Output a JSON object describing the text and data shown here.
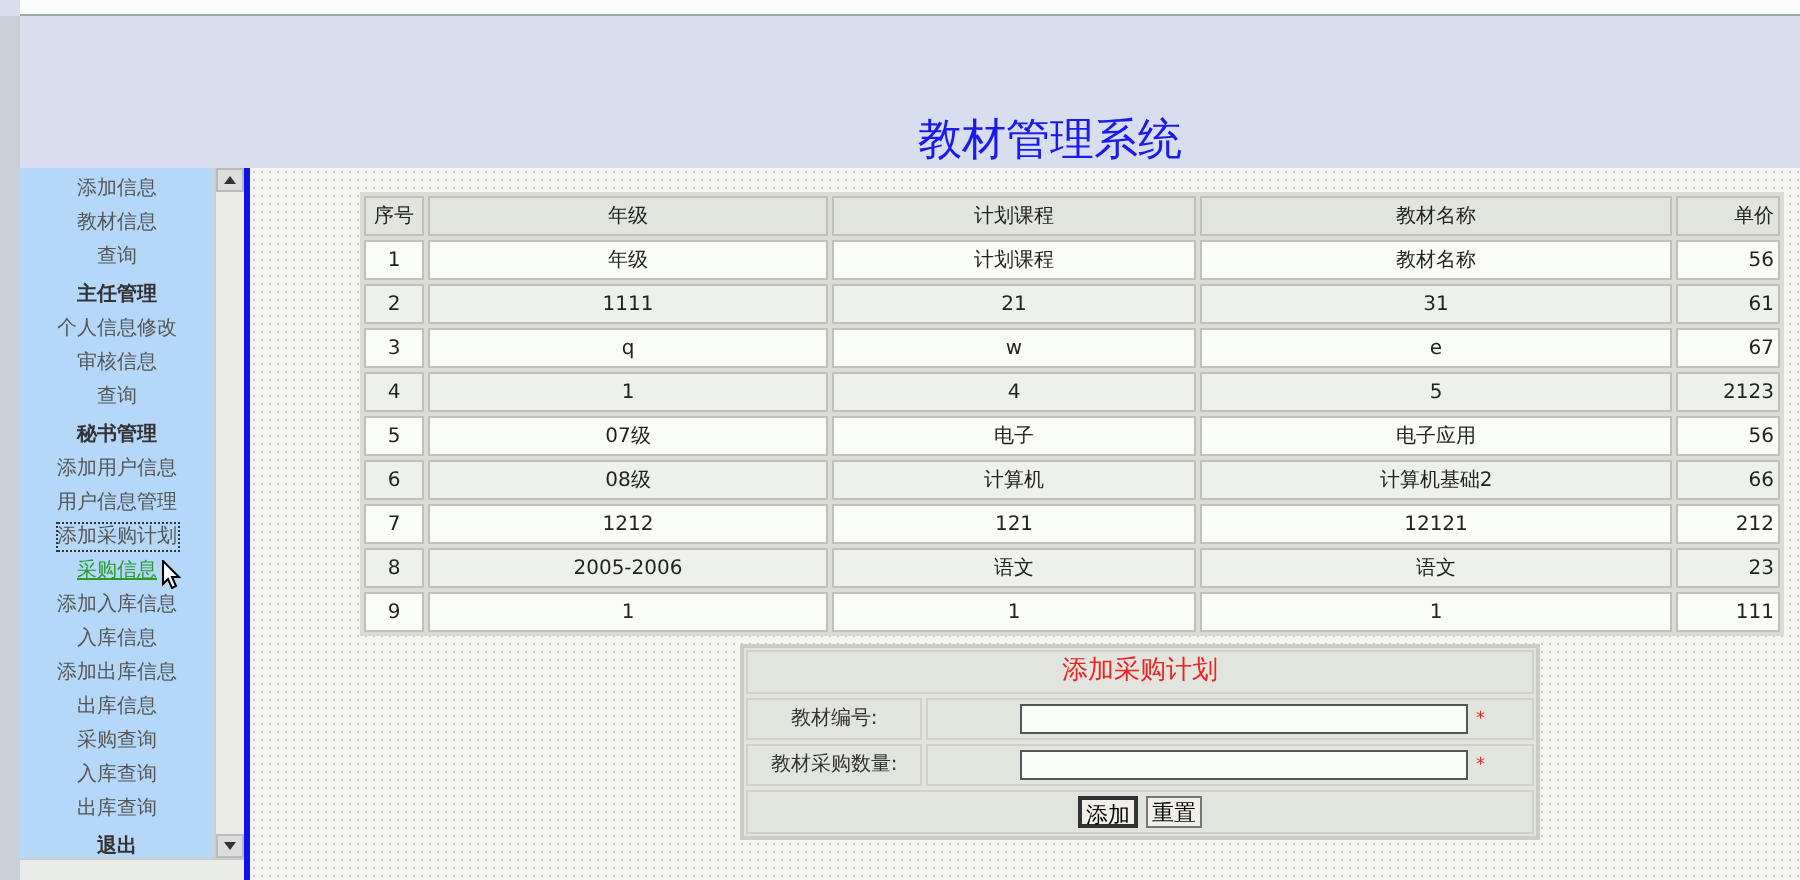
{
  "header": {
    "title": "教材管理系统"
  },
  "sidebar": {
    "items": [
      {
        "kind": "link",
        "label": "添加信息",
        "active": false,
        "focused": false
      },
      {
        "kind": "link",
        "label": "教材信息",
        "active": false,
        "focused": false
      },
      {
        "kind": "link",
        "label": "查询",
        "active": false,
        "focused": false
      },
      {
        "kind": "heading",
        "label": "主任管理"
      },
      {
        "kind": "link",
        "label": "个人信息修改",
        "active": false,
        "focused": false
      },
      {
        "kind": "link",
        "label": "审核信息",
        "active": false,
        "focused": false
      },
      {
        "kind": "link",
        "label": "查询",
        "active": false,
        "focused": false
      },
      {
        "kind": "heading",
        "label": "秘书管理"
      },
      {
        "kind": "link",
        "label": "添加用户信息",
        "active": false,
        "focused": false
      },
      {
        "kind": "link",
        "label": "用户信息管理",
        "active": false,
        "focused": false
      },
      {
        "kind": "link",
        "label": "添加采购计划",
        "active": false,
        "focused": true
      },
      {
        "kind": "link",
        "label": "采购信息",
        "active": true,
        "focused": false
      },
      {
        "kind": "link",
        "label": "添加入库信息",
        "active": false,
        "focused": false
      },
      {
        "kind": "link",
        "label": "入库信息",
        "active": false,
        "focused": false
      },
      {
        "kind": "link",
        "label": "添加出库信息",
        "active": false,
        "focused": false
      },
      {
        "kind": "link",
        "label": "出库信息",
        "active": false,
        "focused": false
      },
      {
        "kind": "link",
        "label": "采购查询",
        "active": false,
        "focused": false
      },
      {
        "kind": "link",
        "label": "入库查询",
        "active": false,
        "focused": false
      },
      {
        "kind": "link",
        "label": "出库查询",
        "active": false,
        "focused": false
      },
      {
        "kind": "heading",
        "label": "退出"
      }
    ]
  },
  "table": {
    "columns": [
      "序号",
      "年级",
      "计划课程",
      "教材名称",
      "单价"
    ],
    "rows": [
      [
        "1",
        "年级",
        "计划课程",
        "教材名称",
        "56"
      ],
      [
        "2",
        "1111",
        "21",
        "31",
        "61"
      ],
      [
        "3",
        "q",
        "w",
        "e",
        "67"
      ],
      [
        "4",
        "1",
        "4",
        "5",
        "2123"
      ],
      [
        "5",
        "07级",
        "电子",
        "电子应用",
        "56"
      ],
      [
        "6",
        "08级",
        "计算机",
        "计算机基础2",
        "66"
      ],
      [
        "7",
        "1212",
        "121",
        "12121",
        "212"
      ],
      [
        "8",
        "2005-2006",
        "语文",
        "语文",
        "23"
      ],
      [
        "9",
        "1",
        "1",
        "1",
        "111"
      ]
    ]
  },
  "form": {
    "title": "添加采购计划",
    "fields": [
      {
        "label": "教材编号:",
        "required_mark": "*"
      },
      {
        "label": "教材采购数量:",
        "required_mark": "*"
      }
    ],
    "buttons": [
      "添加",
      "重置"
    ]
  }
}
